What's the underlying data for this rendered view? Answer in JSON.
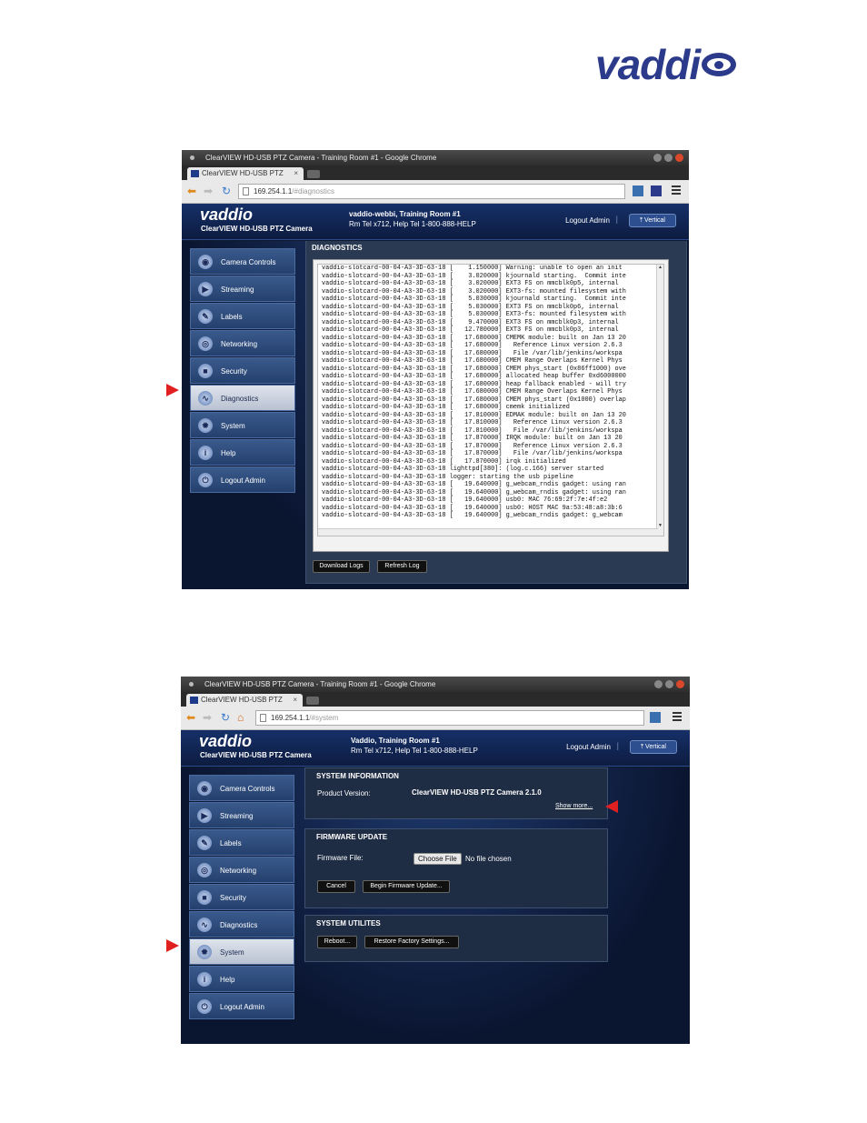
{
  "brand": {
    "logo_text": "vaddi"
  },
  "diag_window": {
    "title": "ClearVIEW HD-USB PTZ Camera - Training Room #1 - Google Chrome",
    "tab_label": "ClearVIEW HD-USB PTZ",
    "tab_close": "×",
    "url_host": "169.254.1.1",
    "url_path": "/#diagnostics",
    "header": {
      "logo": "vaddio",
      "subtitle": "ClearVIEW HD-USB PTZ Camera",
      "room_line1": "vaddio-webbi, Training Room #1",
      "room_line2": "Rm Tel x712, Help Tel 1-800-888-HELP",
      "logout": "Logout Admin",
      "separator": "|",
      "vertical": "Vertical"
    },
    "panel_title": "DIAGNOSTICS",
    "log_lines": [
      "vaddio-slotcard-00-04-A3-3D-63-18 [    1.150000] Warning: unable to open an init",
      "vaddio-slotcard-00-04-A3-3D-63-18 [    3.020000] kjournald starting.  Commit inte",
      "vaddio-slotcard-00-04-A3-3D-63-18 [    3.020000] EXT3 FS on mmcblk0p5, internal",
      "vaddio-slotcard-00-04-A3-3D-63-18 [    3.020000] EXT3-fs: mounted filesystem with",
      "vaddio-slotcard-00-04-A3-3D-63-18 [    5.030000] kjournald starting.  Commit inte",
      "vaddio-slotcard-00-04-A3-3D-63-18 [    5.030000] EXT3 FS on mmcblk0p6, internal",
      "vaddio-slotcard-00-04-A3-3D-63-18 [    5.030000] EXT3-fs: mounted filesystem with",
      "vaddio-slotcard-00-04-A3-3D-63-18 [    9.470000] EXT3 FS on mmcblk0p3, internal",
      "vaddio-slotcard-00-04-A3-3D-63-18 [   12.780000] EXT3 FS on mmcblk0p3, internal",
      "vaddio-slotcard-00-04-A3-3D-63-18 [   17.680000] CMEMK module: built on Jan 13 20",
      "vaddio-slotcard-00-04-A3-3D-63-18 [   17.680000]   Reference Linux version 2.6.3",
      "vaddio-slotcard-00-04-A3-3D-63-18 [   17.680000]   File /var/lib/jenkins/workspa",
      "vaddio-slotcard-00-04-A3-3D-63-18 [   17.680000] CMEM Range Overlaps Kernel Phys",
      "vaddio-slotcard-00-04-A3-3D-63-18 [   17.680000] CMEM phys_start (0x86ff1000) ove",
      "vaddio-slotcard-00-04-A3-3D-63-18 [   17.680000] allocated heap buffer 0xd6000000",
      "vaddio-slotcard-00-04-A3-3D-63-18 [   17.680000] heap fallback enabled - will try",
      "vaddio-slotcard-00-04-A3-3D-63-18 [   17.680000] CMEM Range Overlaps Kernel Phys",
      "vaddio-slotcard-00-04-A3-3D-63-18 [   17.680000] CMEM phys_start (0x1000) overlap",
      "vaddio-slotcard-00-04-A3-3D-63-18 [   17.680000] cmemk initialized",
      "vaddio-slotcard-00-04-A3-3D-63-18 [   17.810000] EDMAK module: built on Jan 13 20",
      "vaddio-slotcard-00-04-A3-3D-63-18 [   17.810000]   Reference Linux version 2.6.3",
      "vaddio-slotcard-00-04-A3-3D-63-18 [   17.810000]   File /var/lib/jenkins/workspa",
      "vaddio-slotcard-00-04-A3-3D-63-18 [   17.870000] IRQK module: built on Jan 13 20",
      "vaddio-slotcard-00-04-A3-3D-63-18 [   17.870000]   Reference Linux version 2.6.3",
      "vaddio-slotcard-00-04-A3-3D-63-18 [   17.870000]   File /var/lib/jenkins/workspa",
      "vaddio-slotcard-00-04-A3-3D-63-18 [   17.870000] irqk initialized",
      "vaddio-slotcard-00-04-A3-3D-63-18 lighttpd[380]: (log.c.166) server started",
      "vaddio-slotcard-00-04-A3-3D-63-18 logger: starting the usb pipeline",
      "vaddio-slotcard-00-04-A3-3D-63-18 [   19.640000] g_webcam_rndis gadget: using ran",
      "vaddio-slotcard-00-04-A3-3D-63-18 [   19.640000] g_webcam_rndis gadget: using ran",
      "vaddio-slotcard-00-04-A3-3D-63-18 [   19.640000] usb0: MAC 76:69:2f:7e:4f:e2",
      "vaddio-slotcard-00-04-A3-3D-63-18 [   19.640000] usb0: HOST MAC 9a:53:48:a8:3b:6",
      "vaddio-slotcard-00-04-A3-3D-63-18 [   19.640000] g_webcam_rndis gadget: g_webcam"
    ],
    "download_logs": "Download Logs",
    "refresh_log": "Refresh Log"
  },
  "sys_window": {
    "title": "ClearVIEW HD-USB PTZ Camera - Training Room #1 - Google Chrome",
    "tab_label": "ClearVIEW HD-USB PTZ",
    "tab_close": "×",
    "url_host": "169.254.1.1",
    "url_path": "/#system",
    "header": {
      "logo": "vaddio",
      "subtitle": "ClearVIEW HD-USB PTZ Camera",
      "room_line1": "Vaddio, Training Room #1",
      "room_line2": "Rm Tel x712, Help Tel 1-800-888-HELP",
      "logout": "Logout Admin",
      "separator": "|",
      "vertical": "Vertical"
    },
    "system_info": {
      "title": "SYSTEM INFORMATION",
      "product_label": "Product Version:",
      "product_value": "ClearVIEW HD-USB PTZ Camera 2.1.0",
      "show_more": "Show more..."
    },
    "firmware": {
      "title": "FIRMWARE UPDATE",
      "file_label": "Firmware File:",
      "choose_file": "Choose File",
      "no_file": "No file chosen",
      "cancel": "Cancel",
      "begin": "Begin Firmware Update..."
    },
    "utilities": {
      "title": "SYSTEM UTILITES",
      "reboot": "Reboot...",
      "restore": "Restore Factory Settings..."
    }
  },
  "sidebar": {
    "items": [
      {
        "label": "Camera Controls",
        "icon": "camera-icon",
        "glyph": "◉"
      },
      {
        "label": "Streaming",
        "icon": "streaming-icon",
        "glyph": "▶"
      },
      {
        "label": "Labels",
        "icon": "labels-icon",
        "glyph": "✎"
      },
      {
        "label": "Networking",
        "icon": "networking-icon",
        "glyph": "◎"
      },
      {
        "label": "Security",
        "icon": "lock-icon",
        "glyph": "■"
      },
      {
        "label": "Diagnostics",
        "icon": "diagnostics-icon",
        "glyph": "∿"
      },
      {
        "label": "System",
        "icon": "gear-icon",
        "glyph": "✹"
      },
      {
        "label": "Help",
        "icon": "info-icon",
        "glyph": "i"
      },
      {
        "label": "Logout Admin",
        "icon": "power-icon",
        "glyph": "⏻"
      }
    ]
  },
  "colors": {
    "brand": "#2b3a8a",
    "accent_arrow": "#e02020"
  }
}
